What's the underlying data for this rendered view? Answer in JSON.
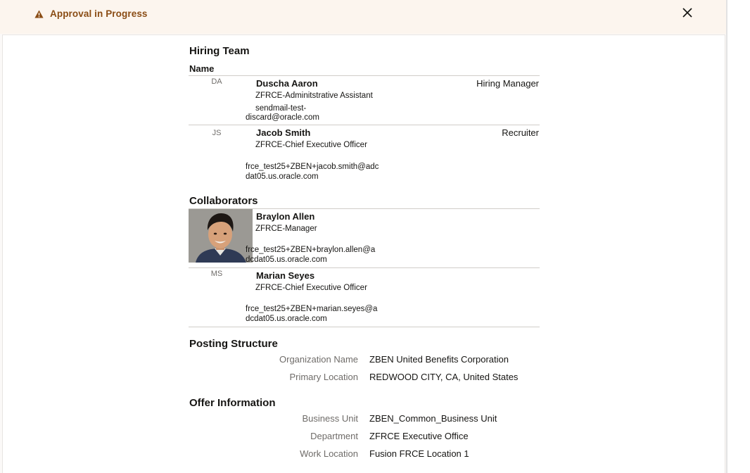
{
  "banner": {
    "title": "Approval in Progress",
    "icon": "warning-icon",
    "close_icon": "close-icon",
    "accent_color": "#8a4c14"
  },
  "hiring_team": {
    "heading": "Hiring Team",
    "column_name": "Name",
    "members": [
      {
        "initials": "DA",
        "name": "Duscha Aaron",
        "job_title": "ZFRCE-Adminitstrative Assistant",
        "email_line1": "sendmail-test-",
        "email_line2": "discard@oracle.com",
        "role": "Hiring Manager"
      },
      {
        "initials": "JS",
        "name": "Jacob Smith",
        "job_title": "ZFRCE-Chief Executive Officer",
        "email_line1": "frce_test25+ZBEN+jacob.smith@adc",
        "email_line2": "dat05.us.oracle.com",
        "role": "Recruiter"
      }
    ]
  },
  "collaborators": {
    "heading": "Collaborators",
    "members": [
      {
        "initials": "",
        "has_photo": true,
        "name": "Braylon Allen",
        "job_title": "ZFRCE-Manager",
        "email_line1": "frce_test25+ZBEN+braylon.allen@a",
        "email_line2": "dcdat05.us.oracle.com"
      },
      {
        "initials": "MS",
        "name": "Marian Seyes",
        "job_title": "ZFRCE-Chief Executive Officer",
        "email_line1": "frce_test25+ZBEN+marian.seyes@a",
        "email_line2": "dcdat05.us.oracle.com"
      }
    ]
  },
  "posting_structure": {
    "heading": "Posting Structure",
    "fields": [
      {
        "label": "Organization Name",
        "value": "ZBEN United Benefits Corporation"
      },
      {
        "label": "Primary Location",
        "value": "REDWOOD CITY, CA, United States"
      }
    ]
  },
  "offer_information": {
    "heading": "Offer Information",
    "fields": [
      {
        "label": "Business Unit",
        "value": "ZBEN_Common_Business Unit"
      },
      {
        "label": "Department",
        "value": "ZFRCE Executive Office"
      },
      {
        "label": "Work Location",
        "value": "Fusion FRCE Location 1"
      }
    ]
  }
}
